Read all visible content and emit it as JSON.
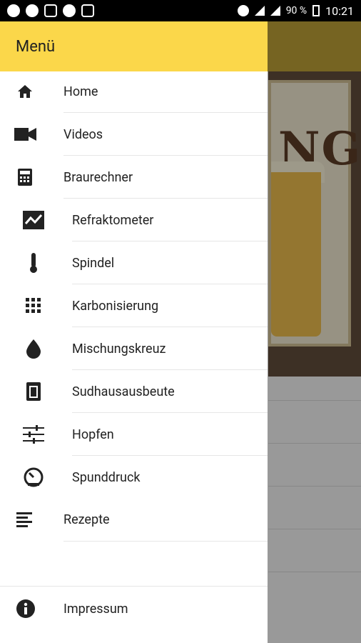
{
  "statusbar": {
    "battery": "90 %",
    "time": "10:21"
  },
  "drawer": {
    "title": "Menü",
    "items": [
      {
        "label": "Home",
        "icon": "home-icon"
      },
      {
        "label": "Videos",
        "icon": "video-camera-icon"
      },
      {
        "label": "Braurechner",
        "icon": "calculator-icon"
      },
      {
        "label": "Refraktometer",
        "icon": "chart-icon"
      },
      {
        "label": "Spindel",
        "icon": "thermometer-icon"
      },
      {
        "label": "Karbonisierung",
        "icon": "grid-dots-icon"
      },
      {
        "label": "Mischungskreuz",
        "icon": "drop-icon"
      },
      {
        "label": "Sudhausausbeute",
        "icon": "container-icon"
      },
      {
        "label": "Hopfen",
        "icon": "sliders-icon"
      },
      {
        "label": "Spunddruck",
        "icon": "gauge-icon"
      },
      {
        "label": "Rezepte",
        "icon": "list-icon"
      },
      {
        "label": "Impressum",
        "icon": "info-icon"
      }
    ]
  },
  "background": {
    "sign_text": "NG"
  }
}
